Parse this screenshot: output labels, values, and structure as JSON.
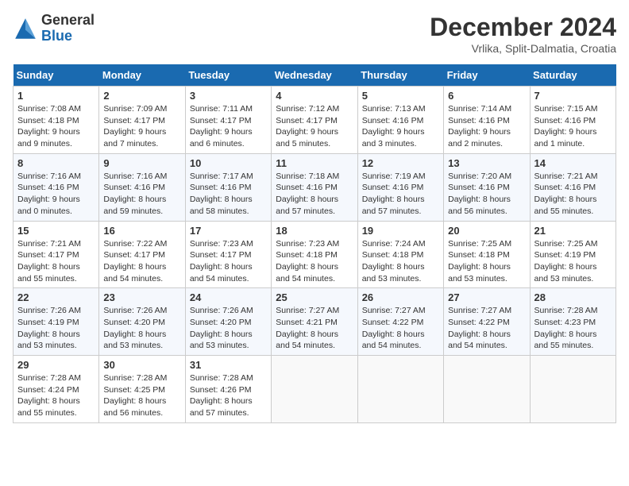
{
  "logo": {
    "general": "General",
    "blue": "Blue"
  },
  "title": "December 2024",
  "subtitle": "Vrlika, Split-Dalmatia, Croatia",
  "days_of_week": [
    "Sunday",
    "Monday",
    "Tuesday",
    "Wednesday",
    "Thursday",
    "Friday",
    "Saturday"
  ],
  "weeks": [
    [
      {
        "day": "1",
        "sunrise": "Sunrise: 7:08 AM",
        "sunset": "Sunset: 4:18 PM",
        "daylight": "Daylight: 9 hours and 9 minutes."
      },
      {
        "day": "2",
        "sunrise": "Sunrise: 7:09 AM",
        "sunset": "Sunset: 4:17 PM",
        "daylight": "Daylight: 9 hours and 7 minutes."
      },
      {
        "day": "3",
        "sunrise": "Sunrise: 7:11 AM",
        "sunset": "Sunset: 4:17 PM",
        "daylight": "Daylight: 9 hours and 6 minutes."
      },
      {
        "day": "4",
        "sunrise": "Sunrise: 7:12 AM",
        "sunset": "Sunset: 4:17 PM",
        "daylight": "Daylight: 9 hours and 5 minutes."
      },
      {
        "day": "5",
        "sunrise": "Sunrise: 7:13 AM",
        "sunset": "Sunset: 4:16 PM",
        "daylight": "Daylight: 9 hours and 3 minutes."
      },
      {
        "day": "6",
        "sunrise": "Sunrise: 7:14 AM",
        "sunset": "Sunset: 4:16 PM",
        "daylight": "Daylight: 9 hours and 2 minutes."
      },
      {
        "day": "7",
        "sunrise": "Sunrise: 7:15 AM",
        "sunset": "Sunset: 4:16 PM",
        "daylight": "Daylight: 9 hours and 1 minute."
      }
    ],
    [
      {
        "day": "8",
        "sunrise": "Sunrise: 7:16 AM",
        "sunset": "Sunset: 4:16 PM",
        "daylight": "Daylight: 9 hours and 0 minutes."
      },
      {
        "day": "9",
        "sunrise": "Sunrise: 7:16 AM",
        "sunset": "Sunset: 4:16 PM",
        "daylight": "Daylight: 8 hours and 59 minutes."
      },
      {
        "day": "10",
        "sunrise": "Sunrise: 7:17 AM",
        "sunset": "Sunset: 4:16 PM",
        "daylight": "Daylight: 8 hours and 58 minutes."
      },
      {
        "day": "11",
        "sunrise": "Sunrise: 7:18 AM",
        "sunset": "Sunset: 4:16 PM",
        "daylight": "Daylight: 8 hours and 57 minutes."
      },
      {
        "day": "12",
        "sunrise": "Sunrise: 7:19 AM",
        "sunset": "Sunset: 4:16 PM",
        "daylight": "Daylight: 8 hours and 57 minutes."
      },
      {
        "day": "13",
        "sunrise": "Sunrise: 7:20 AM",
        "sunset": "Sunset: 4:16 PM",
        "daylight": "Daylight: 8 hours and 56 minutes."
      },
      {
        "day": "14",
        "sunrise": "Sunrise: 7:21 AM",
        "sunset": "Sunset: 4:16 PM",
        "daylight": "Daylight: 8 hours and 55 minutes."
      }
    ],
    [
      {
        "day": "15",
        "sunrise": "Sunrise: 7:21 AM",
        "sunset": "Sunset: 4:17 PM",
        "daylight": "Daylight: 8 hours and 55 minutes."
      },
      {
        "day": "16",
        "sunrise": "Sunrise: 7:22 AM",
        "sunset": "Sunset: 4:17 PM",
        "daylight": "Daylight: 8 hours and 54 minutes."
      },
      {
        "day": "17",
        "sunrise": "Sunrise: 7:23 AM",
        "sunset": "Sunset: 4:17 PM",
        "daylight": "Daylight: 8 hours and 54 minutes."
      },
      {
        "day": "18",
        "sunrise": "Sunrise: 7:23 AM",
        "sunset": "Sunset: 4:18 PM",
        "daylight": "Daylight: 8 hours and 54 minutes."
      },
      {
        "day": "19",
        "sunrise": "Sunrise: 7:24 AM",
        "sunset": "Sunset: 4:18 PM",
        "daylight": "Daylight: 8 hours and 53 minutes."
      },
      {
        "day": "20",
        "sunrise": "Sunrise: 7:25 AM",
        "sunset": "Sunset: 4:18 PM",
        "daylight": "Daylight: 8 hours and 53 minutes."
      },
      {
        "day": "21",
        "sunrise": "Sunrise: 7:25 AM",
        "sunset": "Sunset: 4:19 PM",
        "daylight": "Daylight: 8 hours and 53 minutes."
      }
    ],
    [
      {
        "day": "22",
        "sunrise": "Sunrise: 7:26 AM",
        "sunset": "Sunset: 4:19 PM",
        "daylight": "Daylight: 8 hours and 53 minutes."
      },
      {
        "day": "23",
        "sunrise": "Sunrise: 7:26 AM",
        "sunset": "Sunset: 4:20 PM",
        "daylight": "Daylight: 8 hours and 53 minutes."
      },
      {
        "day": "24",
        "sunrise": "Sunrise: 7:26 AM",
        "sunset": "Sunset: 4:20 PM",
        "daylight": "Daylight: 8 hours and 53 minutes."
      },
      {
        "day": "25",
        "sunrise": "Sunrise: 7:27 AM",
        "sunset": "Sunset: 4:21 PM",
        "daylight": "Daylight: 8 hours and 54 minutes."
      },
      {
        "day": "26",
        "sunrise": "Sunrise: 7:27 AM",
        "sunset": "Sunset: 4:22 PM",
        "daylight": "Daylight: 8 hours and 54 minutes."
      },
      {
        "day": "27",
        "sunrise": "Sunrise: 7:27 AM",
        "sunset": "Sunset: 4:22 PM",
        "daylight": "Daylight: 8 hours and 54 minutes."
      },
      {
        "day": "28",
        "sunrise": "Sunrise: 7:28 AM",
        "sunset": "Sunset: 4:23 PM",
        "daylight": "Daylight: 8 hours and 55 minutes."
      }
    ],
    [
      {
        "day": "29",
        "sunrise": "Sunrise: 7:28 AM",
        "sunset": "Sunset: 4:24 PM",
        "daylight": "Daylight: 8 hours and 55 minutes."
      },
      {
        "day": "30",
        "sunrise": "Sunrise: 7:28 AM",
        "sunset": "Sunset: 4:25 PM",
        "daylight": "Daylight: 8 hours and 56 minutes."
      },
      {
        "day": "31",
        "sunrise": "Sunrise: 7:28 AM",
        "sunset": "Sunset: 4:26 PM",
        "daylight": "Daylight: 8 hours and 57 minutes."
      },
      null,
      null,
      null,
      null
    ]
  ]
}
